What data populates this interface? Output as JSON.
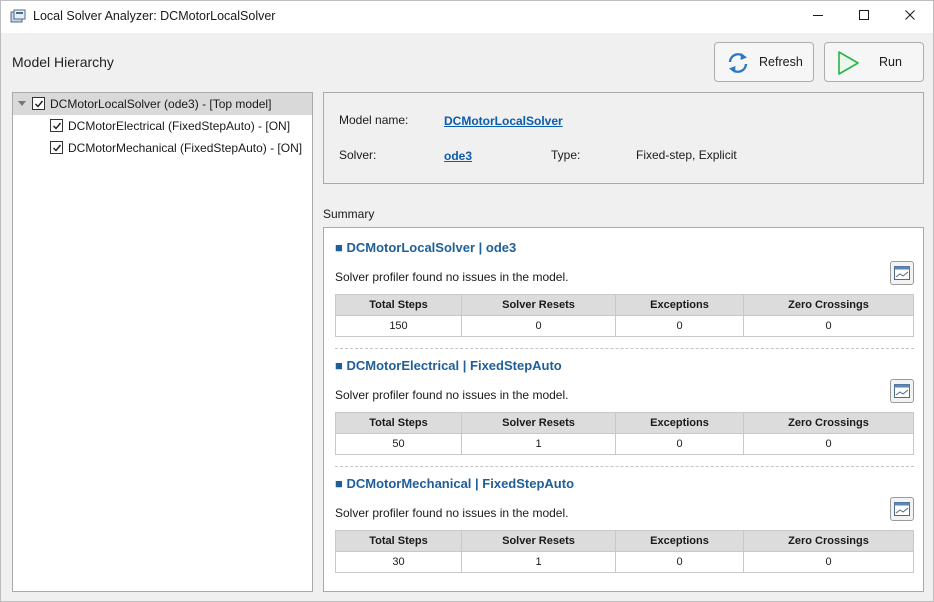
{
  "window": {
    "title": "Local Solver Analyzer: DCMotorLocalSolver",
    "app_icon": "solver-analyzer-icon",
    "controls": [
      "minimize-icon",
      "maximize-icon",
      "close-icon"
    ]
  },
  "hierarchy": {
    "title": "Model Hierarchy",
    "items": [
      {
        "label": "DCMotorLocalSolver (ode3) - [Top model]",
        "checked": true,
        "selected": true,
        "expanded": true,
        "level": 0
      },
      {
        "label": "DCMotorElectrical (FixedStepAuto) - [ON]",
        "checked": true,
        "selected": false,
        "level": 1
      },
      {
        "label": "DCMotorMechanical (FixedStepAuto) - [ON]",
        "checked": true,
        "selected": false,
        "level": 1
      }
    ]
  },
  "toolbar": {
    "refresh_label": "Refresh",
    "refresh_icon": "refresh-icon",
    "run_label": "Run",
    "run_icon": "play-icon"
  },
  "model_info": {
    "model_name_label": "Model name:",
    "model_name_value": "DCMotorLocalSolver",
    "solver_label": "Solver:",
    "solver_value": "ode3",
    "type_label": "Type:",
    "type_value": "Fixed-step, Explicit"
  },
  "summary": {
    "title": "Summary",
    "columns": [
      "Total Steps",
      "Solver Resets",
      "Exceptions",
      "Zero Crossings"
    ],
    "blocks": [
      {
        "title": "■ DCMotorLocalSolver | ode3",
        "message": "Solver profiler found no issues in the model.",
        "values": [
          "150",
          "0",
          "0",
          "0"
        ]
      },
      {
        "title": "■ DCMotorElectrical | FixedStepAuto",
        "message": "Solver profiler found no issues in the model.",
        "values": [
          "50",
          "1",
          "0",
          "0"
        ]
      },
      {
        "title": "■ DCMotorMechanical | FixedStepAuto",
        "message": "Solver profiler found no issues in the model.",
        "values": [
          "30",
          "1",
          "0",
          "0"
        ]
      }
    ]
  },
  "colors": {
    "link": "#0b5cad",
    "block_title": "#1f5f99",
    "run_icon": "#2db34a",
    "refresh_icon": "#2a78c2"
  }
}
